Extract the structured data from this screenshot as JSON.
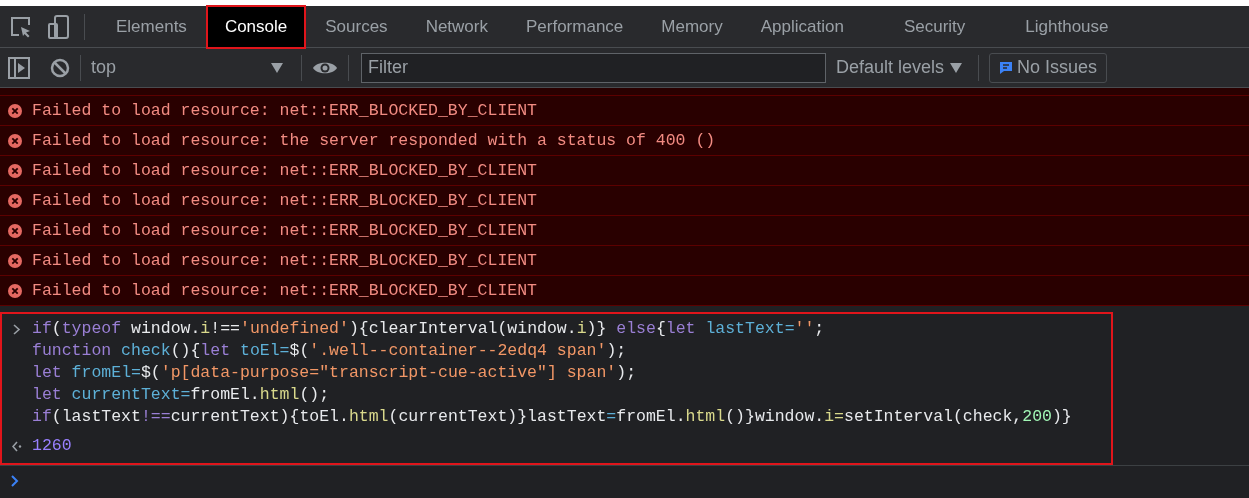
{
  "tabs": [
    {
      "label": "Elements",
      "selected": false,
      "annotated": false
    },
    {
      "label": "Console",
      "selected": true,
      "annotated": true
    },
    {
      "label": "Sources",
      "selected": false,
      "annotated": false
    },
    {
      "label": "Network",
      "selected": false,
      "annotated": false
    },
    {
      "label": "Performance",
      "selected": false,
      "annotated": false
    },
    {
      "label": "Memory",
      "selected": false,
      "annotated": false
    },
    {
      "label": "Application",
      "selected": false,
      "annotated": false
    },
    {
      "label": "Security",
      "selected": false,
      "annotated": false
    },
    {
      "label": "Lighthouse",
      "selected": false,
      "annotated": false
    }
  ],
  "toolbar": {
    "context": "top",
    "filter_placeholder": "Filter",
    "levels": "Default levels",
    "issues": "No Issues"
  },
  "messages": [
    {
      "kind": "error",
      "text": "Failed to load resource: net::ERR_BLOCKED_BY_CLIENT"
    },
    {
      "kind": "error",
      "text": "Failed to load resource: the server responded with a status of 400 ()"
    },
    {
      "kind": "error",
      "text": "Failed to load resource: net::ERR_BLOCKED_BY_CLIENT"
    },
    {
      "kind": "error",
      "text": "Failed to load resource: net::ERR_BLOCKED_BY_CLIENT"
    },
    {
      "kind": "error",
      "text": "Failed to load resource: net::ERR_BLOCKED_BY_CLIENT"
    },
    {
      "kind": "error",
      "text": "Failed to load resource: net::ERR_BLOCKED_BY_CLIENT"
    },
    {
      "kind": "error",
      "text": "Failed to load resource: net::ERR_BLOCKED_BY_CLIENT"
    }
  ],
  "input": {
    "annotated": true,
    "lines": [
      [
        {
          "kind": "keyword",
          "text": "if"
        },
        {
          "kind": "plain",
          "text": "("
        },
        {
          "kind": "keyword",
          "text": "typeof"
        },
        {
          "kind": "plain",
          "text": " window."
        },
        {
          "kind": "property",
          "text": "i"
        },
        {
          "kind": "plain",
          "text": "!=="
        },
        {
          "kind": "string",
          "text": "'undefined'"
        },
        {
          "kind": "plain",
          "text": "){clearInterval(window."
        },
        {
          "kind": "property",
          "text": "i"
        },
        {
          "kind": "plain",
          "text": ")} "
        },
        {
          "kind": "keyword",
          "text": "else"
        },
        {
          "kind": "plain",
          "text": "{"
        },
        {
          "kind": "keyword",
          "text": "let"
        },
        {
          "kind": "variable",
          "text": " lastText="
        },
        {
          "kind": "string",
          "text": "''"
        },
        {
          "kind": "plain",
          "text": ";"
        }
      ],
      [
        {
          "kind": "keyword",
          "text": "function"
        },
        {
          "kind": "variable",
          "text": " check"
        },
        {
          "kind": "plain",
          "text": "(){"
        },
        {
          "kind": "keyword",
          "text": "let"
        },
        {
          "kind": "variable",
          "text": " toEl="
        },
        {
          "kind": "plain",
          "text": "$("
        },
        {
          "kind": "string",
          "text": "'.well--container--2edq4 span'"
        },
        {
          "kind": "plain",
          "text": ");"
        }
      ],
      [
        {
          "kind": "keyword",
          "text": "let"
        },
        {
          "kind": "variable",
          "text": " fromEl="
        },
        {
          "kind": "plain",
          "text": "$("
        },
        {
          "kind": "string",
          "text": "'p[data-purpose=\"transcript-cue-active\"] span'"
        },
        {
          "kind": "plain",
          "text": ");"
        }
      ],
      [
        {
          "kind": "keyword",
          "text": "let"
        },
        {
          "kind": "variable",
          "text": " currentText="
        },
        {
          "kind": "plain",
          "text": "fromEl."
        },
        {
          "kind": "property",
          "text": "html"
        },
        {
          "kind": "plain",
          "text": "();"
        }
      ],
      [
        {
          "kind": "keyword",
          "text": "if"
        },
        {
          "kind": "plain",
          "text": "(lastText"
        },
        {
          "kind": "keyword",
          "text": "!=="
        },
        {
          "kind": "plain",
          "text": "currentText){toEl."
        },
        {
          "kind": "property",
          "text": "html"
        },
        {
          "kind": "plain",
          "text": "(currentText)}lastText"
        },
        {
          "kind": "variable",
          "text": "="
        },
        {
          "kind": "plain",
          "text": "fromEl."
        },
        {
          "kind": "property",
          "text": "html"
        },
        {
          "kind": "plain",
          "text": "()}window."
        },
        {
          "kind": "property",
          "text": "i="
        },
        {
          "kind": "plain",
          "text": "setInterval(check,"
        },
        {
          "kind": "number",
          "text": "200"
        },
        {
          "kind": "plain",
          "text": ")}"
        }
      ]
    ],
    "result": "1260"
  }
}
